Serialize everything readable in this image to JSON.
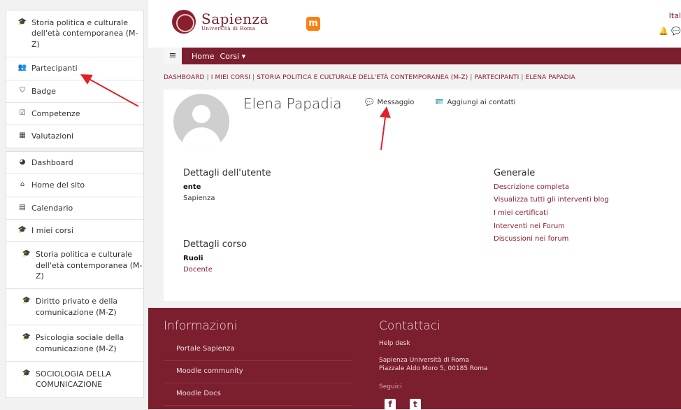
{
  "sidebar": {
    "course_block": [
      {
        "label": "Storia politica e culturale dell'età contemporanea (M-Z)",
        "icon": "graduation-cap-icon"
      },
      {
        "label": "Partecipanti",
        "icon": "users-icon"
      },
      {
        "label": "Badge",
        "icon": "shield-icon"
      },
      {
        "label": "Competenze",
        "icon": "checkbox-icon"
      },
      {
        "label": "Valutazioni",
        "icon": "table-icon"
      }
    ],
    "site_block": [
      {
        "label": "Dashboard",
        "icon": "dashboard-icon"
      },
      {
        "label": "Home del sito",
        "icon": "home-icon"
      },
      {
        "label": "Calendario",
        "icon": "calendar-icon"
      },
      {
        "label": "I miei corsi",
        "icon": "graduation-cap-icon"
      },
      {
        "label": "Storia politica e culturale dell'età contemporanea (M-Z)",
        "icon": "graduation-cap-icon"
      },
      {
        "label": "Diritto privato e della comunicazione (M-Z)",
        "icon": "graduation-cap-icon"
      },
      {
        "label": "Psicologia sociale della comunicazione (M-Z)",
        "icon": "graduation-cap-icon"
      },
      {
        "label": "SOCIOLOGIA DELLA COMUNICAZIONE",
        "icon": "graduation-cap-icon"
      }
    ]
  },
  "header": {
    "logo_name": "Sapienza",
    "logo_sub": "Università di Roma",
    "moodle_icon": "m",
    "language": "Ital"
  },
  "navbar": {
    "home": "Home",
    "courses": "Corsi"
  },
  "breadcrumb": [
    "DASHBOARD",
    "I MIEI CORSI",
    "STORIA POLITICA E CULTURALE DELL'ETÀ CONTEMPORANEA (M-Z)",
    "PARTECIPANTI",
    "ELENA PAPADIA"
  ],
  "profile": {
    "name": "Elena Papadia",
    "message_label": "Messaggio",
    "add_contact_label": "Aggiungi ai contatti",
    "user_details_title": "Dettagli dell'utente",
    "field_label": "ente",
    "field_value": "Sapienza",
    "course_details_title": "Dettagli corso",
    "roles_label": "Ruoli",
    "role_value": "Docente",
    "general_title": "Generale",
    "general_links": [
      "Descrizione completa",
      "Visualizza tutti gli interventi blog",
      "I miei certificati",
      "Interventi nei Forum",
      "Discussioni nei forum"
    ]
  },
  "footer": {
    "info_title": "Informazioni",
    "info_links": [
      "Portale Sapienza",
      "Moodle community",
      "Moodle Docs"
    ],
    "contact_title": "Contattaci",
    "helpdesk": "Help desk",
    "address_line1": "Sapienza Università di Roma",
    "address_line2": "Piazzale Aldo Moro 5, 00185 Roma",
    "follow": "Seguici"
  },
  "colors": {
    "brand": "#7b1e2e",
    "annotation": "#e0202a"
  }
}
